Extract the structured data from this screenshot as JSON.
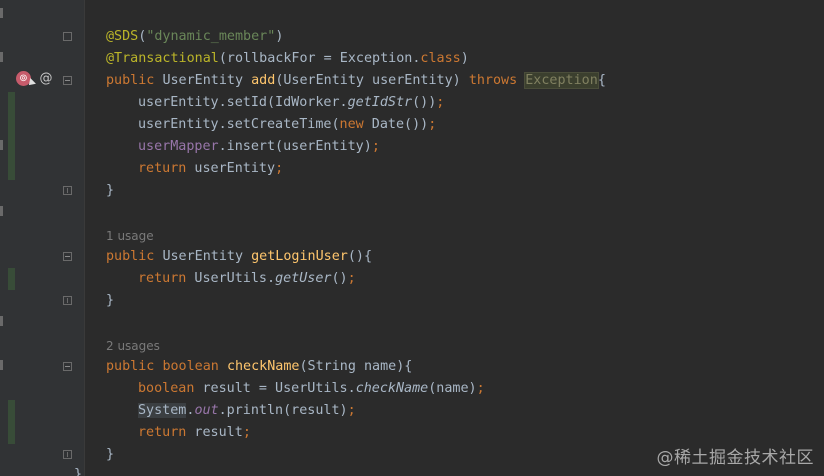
{
  "colors": {
    "background": "#2b2b2b",
    "gutter": "#313335",
    "keyword": "#cc7832",
    "annotation": "#bbb529",
    "string": "#6a8759",
    "method_declaration": "#ffc66d",
    "field": "#9876aa",
    "default_text": "#a9b7c6",
    "inlay_hint": "#7a7a7a"
  },
  "gutter": {
    "icons": [
      "implementation-marker-icon",
      "annotation-at-icon"
    ],
    "at_symbol": "@",
    "impl_glyph": "⊚"
  },
  "code": {
    "annotation_sds": "@SDS",
    "annotation_sds_arg": "\"dynamic_member\"",
    "annotation_tx": "@Transactional",
    "annotation_tx_args": "(rollbackFor = Exception.",
    "class_kw": "class",
    "close_paren": ")",
    "add_line": {
      "public": "public",
      "type": "UserEntity",
      "name": "add",
      "params": "(UserEntity userEntity)",
      "throws": "throws",
      "exception": "Exception",
      "brace": "{"
    },
    "set_id": {
      "prefix": "userEntity.setId(IdWorker.",
      "italic": "getIdStr",
      "suffix": "())",
      "semicolon": ";"
    },
    "set_create_time": {
      "prefix": "userEntity.setCreateTime(",
      "new": "new",
      "suffix": " Date())",
      "semicolon": ";"
    },
    "insert": {
      "field": "userMapper",
      "suffix": ".insert(userEntity)",
      "semicolon": ";"
    },
    "return_entity": {
      "kw": "return",
      "value": " userEntity",
      "semicolon": ";"
    },
    "close_brace": "}",
    "usage_1": "1 usage",
    "get_login_user": {
      "public": "public",
      "type": "UserEntity",
      "name": "getLoginUser",
      "rest": "(){"
    },
    "return_user": {
      "kw": "return",
      "prefix": " UserUtils.",
      "italic": "getUser",
      "suffix": "()",
      "semicolon": ";"
    },
    "usage_2": "2 usages",
    "check_name": {
      "public": "public",
      "boolean": "boolean",
      "name": "checkName",
      "rest": "(String name){"
    },
    "bool_result": {
      "kw": "boolean",
      "prefix": " result = UserUtils.",
      "italic": "checkName",
      "suffix": "(name)",
      "semicolon": ";"
    },
    "println": {
      "system": "System",
      "dot": ".",
      "out": "out",
      "suffix": ".println(result)",
      "semicolon": ";"
    },
    "return_result": {
      "kw": "return",
      "value": " result",
      "semicolon": ";"
    }
  },
  "watermark": "@稀土掘金技术社区"
}
